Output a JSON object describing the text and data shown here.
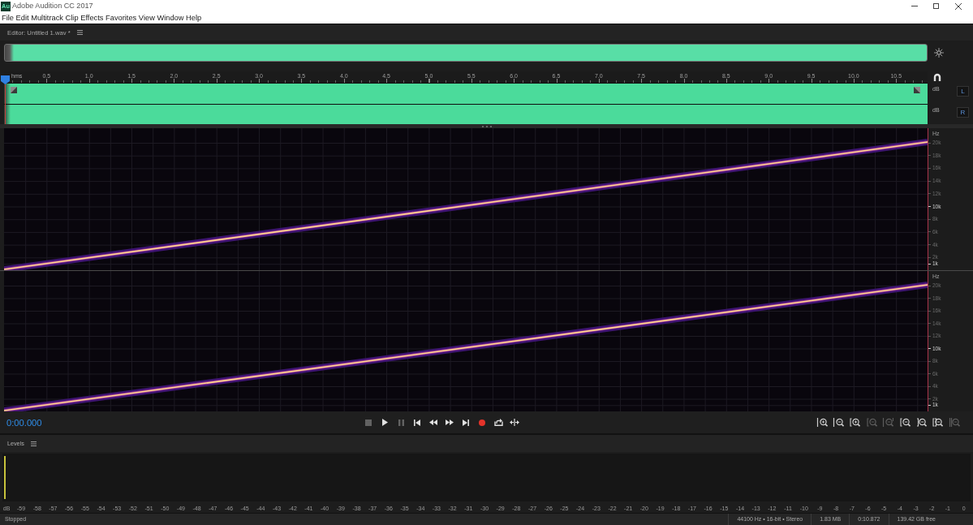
{
  "window": {
    "app_icon": "Au",
    "title": "Adobe Audition CC 2017"
  },
  "menu": [
    "File",
    "Edit",
    "Multitrack",
    "Clip",
    "Effects",
    "Favorites",
    "View",
    "Window",
    "Help"
  ],
  "editor": {
    "tab_title": "Editor: Untitled 1.wav *",
    "timeline": {
      "unit": "hms",
      "labels": [
        "0.5",
        "1.0",
        "1.5",
        "2.0",
        "2.5",
        "3.0",
        "3.5",
        "4.0",
        "4.5",
        "5.0",
        "5.5",
        "6.0",
        "6.5",
        "7.0",
        "7.5",
        "8.0",
        "8.5",
        "9.0",
        "9.5",
        "10.0",
        "10.5"
      ]
    },
    "channels": [
      {
        "label": "L",
        "amplitude_unit": "dB",
        "hz_unit": "Hz",
        "hz_ticks": [
          {
            "label": "20k",
            "major": false
          },
          {
            "label": "18k",
            "major": false
          },
          {
            "label": "16k",
            "major": false
          },
          {
            "label": "14k",
            "major": false
          },
          {
            "label": "12k",
            "major": false
          },
          {
            "label": "10k",
            "major": true
          },
          {
            "label": "8k",
            "major": false
          },
          {
            "label": "6k",
            "major": false
          },
          {
            "label": "4k",
            "major": false
          },
          {
            "label": "2k",
            "major": false
          },
          {
            "label": "1k",
            "major": true
          }
        ]
      },
      {
        "label": "R",
        "amplitude_unit": "dB",
        "hz_unit": "Hz",
        "hz_ticks": [
          {
            "label": "20k",
            "major": false
          },
          {
            "label": "18k",
            "major": false
          },
          {
            "label": "16k",
            "major": false
          },
          {
            "label": "14k",
            "major": false
          },
          {
            "label": "12k",
            "major": false
          },
          {
            "label": "10k",
            "major": true
          },
          {
            "label": "8k",
            "major": false
          },
          {
            "label": "6k",
            "major": false
          },
          {
            "label": "4k",
            "major": false
          },
          {
            "label": "2k",
            "major": false
          },
          {
            "label": "1k",
            "major": true
          }
        ]
      }
    ]
  },
  "transport": {
    "time": "0:00.000",
    "buttons": [
      {
        "kind": "stop",
        "disabled": true
      },
      {
        "kind": "play",
        "disabled": false
      },
      {
        "kind": "pause",
        "disabled": true
      },
      {
        "kind": "to_start",
        "disabled": false
      },
      {
        "kind": "rewind",
        "disabled": false
      },
      {
        "kind": "fast_forward",
        "disabled": false
      },
      {
        "kind": "to_end",
        "disabled": false
      },
      {
        "kind": "record",
        "disabled": false
      },
      {
        "kind": "loop",
        "disabled": false
      },
      {
        "kind": "skip",
        "disabled": false
      }
    ],
    "zoom_buttons": [
      {
        "kind": "in_amplitude",
        "disabled": false
      },
      {
        "kind": "out_amplitude",
        "disabled": false
      },
      {
        "kind": "in_time",
        "disabled": false
      },
      {
        "kind": "out_time",
        "disabled": true
      },
      {
        "kind": "out_full",
        "disabled": true
      },
      {
        "kind": "in_point",
        "disabled": false
      },
      {
        "kind": "out_point",
        "disabled": false
      },
      {
        "kind": "selection",
        "disabled": false
      },
      {
        "kind": "selected_tracks",
        "disabled": true
      }
    ]
  },
  "levels": {
    "title": "Levels",
    "scale": [
      "dB",
      "-59",
      "-58",
      "-57",
      "-56",
      "-55",
      "-54",
      "-53",
      "-52",
      "-51",
      "-50",
      "-49",
      "-48",
      "-47",
      "-46",
      "-45",
      "-44",
      "-43",
      "-42",
      "-41",
      "-40",
      "-39",
      "-38",
      "-37",
      "-36",
      "-35",
      "-34",
      "-33",
      "-32",
      "-31",
      "-30",
      "-29",
      "-28",
      "-27",
      "-26",
      "-25",
      "-24",
      "-23",
      "-22",
      "-21",
      "-20",
      "-19",
      "-18",
      "-17",
      "-16",
      "-15",
      "-14",
      "-13",
      "-12",
      "-11",
      "-10",
      "-9",
      "-8",
      "-7",
      "-6",
      "-5",
      "-4",
      "-3",
      "-2",
      "-1",
      "0"
    ]
  },
  "status_bar": {
    "state": "Stopped",
    "format": "44100 Hz • 16-bit • Stereo",
    "size": "1.83 MB",
    "duration": "0:10.872",
    "free_space": "139.42 GB free"
  }
}
